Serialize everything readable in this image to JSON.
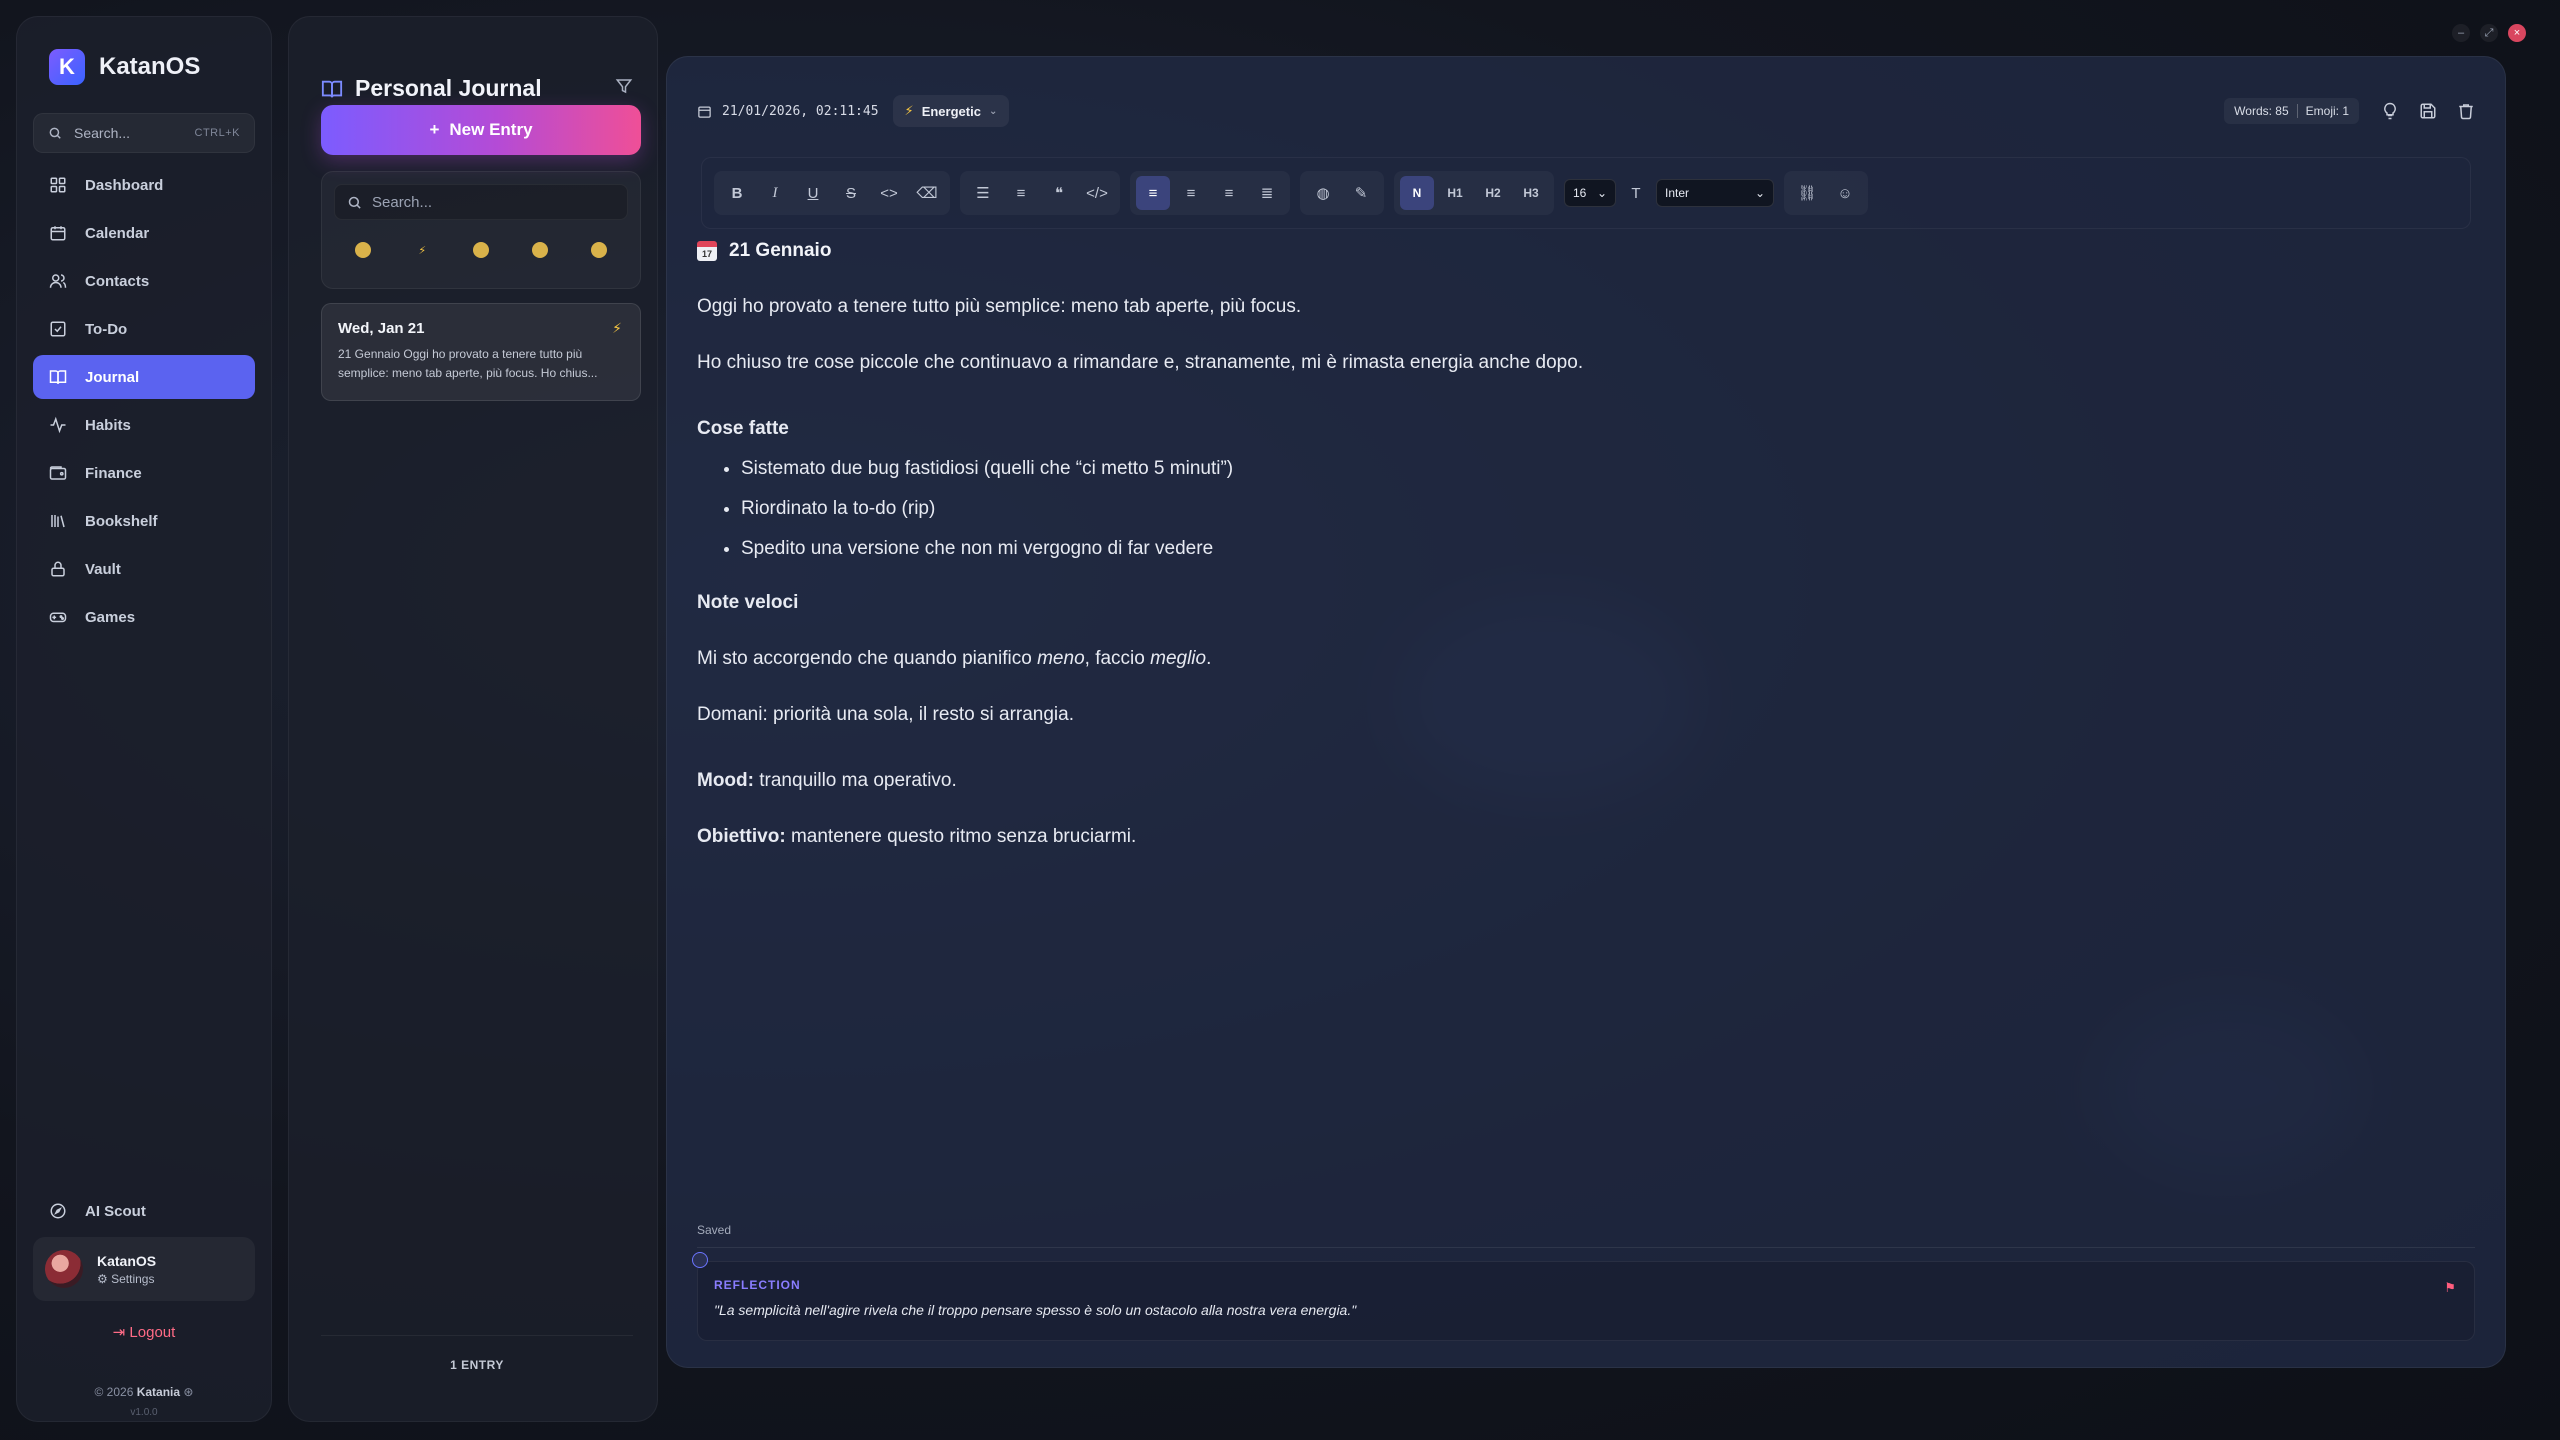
{
  "window": {
    "minimize": "–",
    "maximize": "⤢",
    "close": "×"
  },
  "sidebar": {
    "brand": "KatanOS",
    "brand_letter": "K",
    "search": {
      "placeholder": "Search...",
      "shortcut": "CTRL+K"
    },
    "items": [
      {
        "label": "Dashboard",
        "icon": "dashboard-icon"
      },
      {
        "label": "Calendar",
        "icon": "calendar-icon"
      },
      {
        "label": "Contacts",
        "icon": "contacts-icon"
      },
      {
        "label": "To-Do",
        "icon": "todo-icon"
      },
      {
        "label": "Journal",
        "icon": "journal-icon",
        "active": true
      },
      {
        "label": "Habits",
        "icon": "habits-icon"
      },
      {
        "label": "Finance",
        "icon": "finance-icon"
      },
      {
        "label": "Bookshelf",
        "icon": "bookshelf-icon"
      },
      {
        "label": "Vault",
        "icon": "vault-icon"
      },
      {
        "label": "Games",
        "icon": "games-icon"
      }
    ],
    "ai_scout": "AI Scout",
    "profile": {
      "name": "KatanOS",
      "sub": "⚙ Settings"
    },
    "logout": "Logout",
    "copyright_prefix": "© 2026",
    "copyright_brand": "Katania",
    "copyright_suffix": "⊛",
    "version": "v1.0.0"
  },
  "journal_list": {
    "title": "Personal Journal",
    "new_entry": "New Entry",
    "search_placeholder": "Search...",
    "entries": [
      {
        "date": "Wed, Jan 21",
        "mood": "⚡",
        "preview": "21 Gennaio Oggi ho provato a tenere tutto più semplice: meno tab aperte, più focus. Ho chius..."
      }
    ],
    "footer": "1 ENTRY"
  },
  "editor": {
    "datetime": "21/01/2026, 02:11:45",
    "mood": "Energetic",
    "words": "Words: 85",
    "emoji": "Emoji: 1",
    "font_size": "16",
    "font_family": "Inter",
    "heading_normal": "N",
    "h1": "H1",
    "h2": "H2",
    "h3": "H3",
    "content": {
      "title": "21 Gennaio",
      "p1": "Oggi ho provato a tenere tutto più semplice: meno tab aperte, più focus.",
      "p2": "Ho chiuso tre cose piccole che continuavo a rimandare e, stranamente, mi è rimasta energia anche dopo.",
      "section1": "Cose fatte",
      "bullets": [
        "Sistemato due bug fastidiosi (quelli che “ci metto 5 minuti”)",
        "Riordinato la to-do (rip)",
        "Spedito una versione che non mi vergogno di far vedere"
      ],
      "section2": "Note veloci",
      "p3_a": "Mi sto accorgendo che quando pianifico ",
      "p3_em1": "meno",
      "p3_b": ", faccio ",
      "p3_em2": "meglio",
      "p3_c": ".",
      "p4": "Domani: priorità una sola, il resto si arrangia.",
      "mood_label": "Mood:",
      "mood_text": " tranquillo ma operativo.",
      "goal_label": "Obiettivo:",
      "goal_text": " mantenere questo ritmo senza bruciarmi."
    },
    "saved": "Saved",
    "reflection": {
      "label": "REFLECTION",
      "text": "\"La semplicità nell'agire rivela che il troppo pensare spesso è solo un ostacolo alla nostra vera energia.\""
    }
  },
  "colors": {
    "accent": "#5b63f0",
    "gradient_start": "#7c5cff",
    "gradient_end": "#ef4f97",
    "mood_yellow": "#f5c542",
    "danger": "#ff5d7e"
  }
}
